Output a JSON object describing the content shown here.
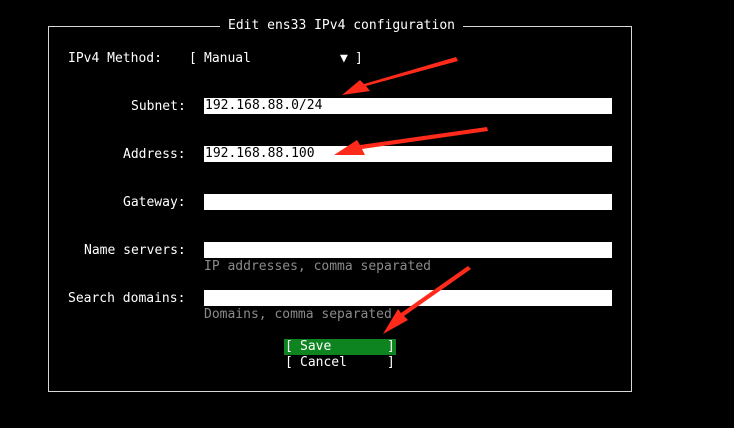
{
  "dialog": {
    "title": "Edit ens33 IPv4 configuration"
  },
  "ipv4_method": {
    "label": "IPv4 Method:",
    "open_bracket": "[",
    "value": "Manual",
    "arrow": "▼",
    "close_bracket": "]"
  },
  "fields": {
    "subnet": {
      "label": "Subnet:",
      "value": "192.168.88.0/24"
    },
    "address": {
      "label": "Address:",
      "value": "192.168.88.100"
    },
    "gateway": {
      "label": "Gateway:",
      "value": ""
    },
    "name_servers": {
      "label": "Name servers:",
      "value": "",
      "hint": "IP addresses, comma separated"
    },
    "search_domains": {
      "label": "Search domains:",
      "value": "",
      "hint": "Domains, comma separated"
    }
  },
  "buttons": {
    "open_bracket": "[",
    "close_bracket": "]",
    "save_label": "Save",
    "cancel_label": "Cancel"
  },
  "colors": {
    "background": "#000000",
    "text": "#ffffff",
    "field_bg": "#ffffff",
    "hint": "#8a8a8a",
    "save_highlight": "#0e8420",
    "annotation_arrow": "#ff2a1a"
  },
  "icons": {
    "dropdown": "triangle-down-icon",
    "annotation": "red-arrow-icon"
  }
}
